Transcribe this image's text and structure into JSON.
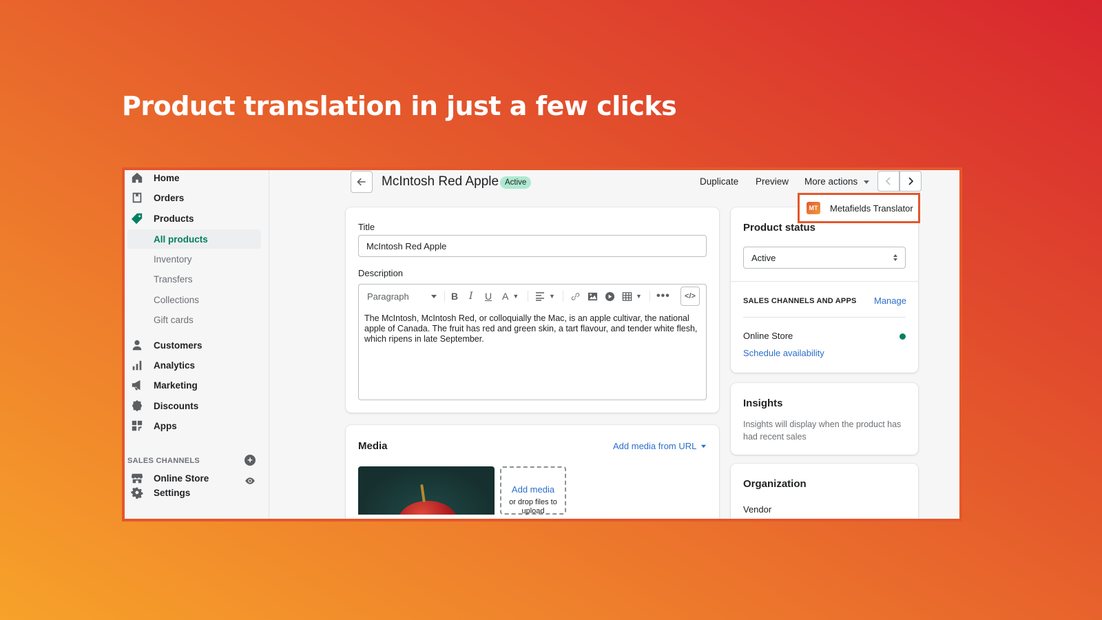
{
  "headline": "Product translation in just a few clicks",
  "sidebar": {
    "items": [
      {
        "label": "Home",
        "icon": "home-icon"
      },
      {
        "label": "Orders",
        "icon": "orders-icon"
      },
      {
        "label": "Products",
        "icon": "tag-icon"
      },
      {
        "label": "Customers",
        "icon": "person-icon"
      },
      {
        "label": "Analytics",
        "icon": "bar-chart-icon"
      },
      {
        "label": "Marketing",
        "icon": "megaphone-icon"
      },
      {
        "label": "Discounts",
        "icon": "discount-icon"
      },
      {
        "label": "Apps",
        "icon": "apps-icon"
      }
    ],
    "product_subitems": [
      "All products",
      "Inventory",
      "Transfers",
      "Collections",
      "Gift cards"
    ],
    "sales_channels_label": "SALES CHANNELS",
    "online_store": "Online Store",
    "settings": "Settings"
  },
  "header": {
    "title": "McIntosh Red Apple",
    "status": "Active",
    "duplicate": "Duplicate",
    "preview": "Preview",
    "more_actions": "More actions"
  },
  "more_actions_menu": {
    "item": "Metafields Translator",
    "logo_text": "MT"
  },
  "product_form": {
    "title_label": "Title",
    "title_value": "McIntosh Red Apple",
    "description_label": "Description",
    "paragraph_select": "Paragraph",
    "description_text": "The McIntosh, McIntosh Red, or colloquially the Mac, is an apple cultivar, the national apple of Canada. The fruit has red and green skin, a tart flavour, and tender white flesh, which ripens in late September."
  },
  "media": {
    "heading": "Media",
    "add_from_url": "Add media from URL",
    "add_media": "Add media",
    "drop_hint": "or drop files to upload"
  },
  "product_status": {
    "heading": "Product status",
    "value": "Active",
    "channels_heading": "SALES CHANNELS AND APPS",
    "manage": "Manage",
    "channel": "Online Store",
    "schedule": "Schedule availability"
  },
  "insights": {
    "heading": "Insights",
    "text": "Insights will display when the product has had recent sales"
  },
  "organization": {
    "heading": "Organization",
    "vendor_label": "Vendor"
  },
  "colors": {
    "accent": "#e4572c",
    "active_nav": "#007f5f",
    "link": "#2c6ecb",
    "status_badge": "#aee9d1"
  }
}
